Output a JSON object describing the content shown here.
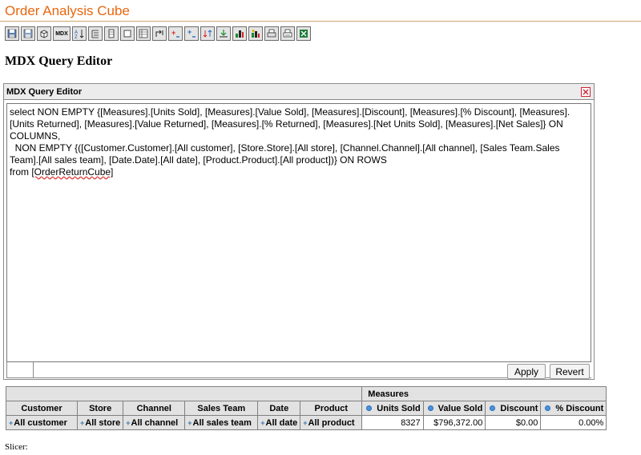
{
  "app": {
    "title": "Order Analysis Cube"
  },
  "toolbar": {
    "buttons": [
      {
        "icon": "save-icon"
      },
      {
        "icon": "save-as-icon"
      },
      {
        "icon": "cube-navigator-icon"
      },
      {
        "icon": "mdx-icon",
        "label": "MDX"
      },
      {
        "icon": "sort-icon"
      },
      {
        "icon": "hierarchy-icon"
      },
      {
        "icon": "column-icon"
      },
      {
        "icon": "outline-icon"
      },
      {
        "icon": "layout-icon"
      },
      {
        "icon": "swap-axes-icon"
      },
      {
        "icon": "expand-members-icon"
      },
      {
        "icon": "collapse-members-icon"
      },
      {
        "icon": "drill-through-icon"
      },
      {
        "icon": "drill-down-icon"
      },
      {
        "icon": "chart-icon"
      },
      {
        "icon": "chart-config-icon"
      },
      {
        "icon": "print-icon"
      },
      {
        "icon": "print-setup-icon"
      },
      {
        "icon": "excel-icon"
      }
    ]
  },
  "page": {
    "heading": "MDX Query Editor"
  },
  "editor": {
    "panel_title": "MDX Query Editor",
    "query_text": "select NON EMPTY {[Measures].[Units Sold], [Measures].[Value Sold], [Measures].[Discount], [Measures].[% Discount], [Measures].[Units Returned], [Measures].[Value Returned], [Measures].[% Returned], [Measures].[Net Units Sold], [Measures].[Net Sales]} ON COLUMNS,\n  NON EMPTY {([Customer.Customer].[All customer], [Store.Store].[All store], [Channel.Channel].[All channel], [Sales Team.Sales Team].[All sales team], [Date.Date].[All date], [Product.Product].[All product])} ON ROWS\nfrom ",
    "cube_ref": "[OrderReturnCube]",
    "apply_label": "Apply",
    "revert_label": "Revert"
  },
  "grid": {
    "measures_label": "Measures",
    "dimension_headers": [
      "Customer",
      "Store",
      "Channel",
      "Sales Team",
      "Date",
      "Product"
    ],
    "measure_headers": [
      "Units Sold",
      "Value Sold",
      "Discount",
      "% Discount"
    ],
    "row_members": [
      "All customer",
      "All store",
      "All channel",
      "All sales team",
      "All date",
      "All product"
    ],
    "row_values": [
      "8327",
      "$796,372.00",
      "$0.00",
      "0.00%"
    ]
  },
  "slicer": {
    "label": "Slicer:"
  },
  "colors": {
    "title": "#e8660e",
    "header_bg": "#e2e2e2",
    "member_expand": "#3977b4",
    "close": "#cc2233"
  }
}
